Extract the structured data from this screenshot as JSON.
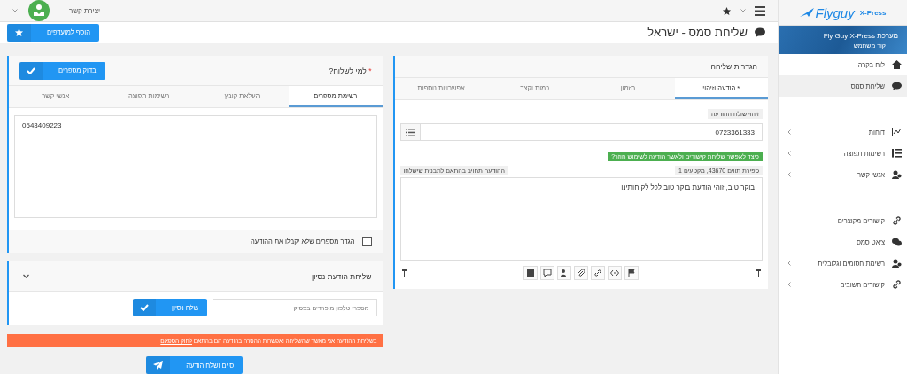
{
  "topbar": {
    "user_label": "יצירת קשר",
    "logo": {
      "word": "Flyguy",
      "suffix": "X-Press"
    }
  },
  "sidebar": {
    "header": {
      "title": "מערכת Fly Guy X-Press",
      "subtitle": "קוד משתמש"
    },
    "groups": [
      [
        {
          "label": "לוח בקרה",
          "selected": false,
          "expandable": false
        },
        {
          "label": "שליחת סמס",
          "selected": true,
          "expandable": false
        }
      ],
      [
        {
          "label": "דוחות",
          "selected": false,
          "expandable": true
        },
        {
          "label": "רשימות תפוצה",
          "selected": false,
          "expandable": true
        },
        {
          "label": "אנשי קשר",
          "selected": false,
          "expandable": true
        }
      ],
      [
        {
          "label": "קישורים מקוצרים",
          "selected": false,
          "expandable": false
        },
        {
          "label": "צ'אט סמס",
          "selected": false,
          "expandable": false
        },
        {
          "label": "רשימת חסומים וגלובלית",
          "selected": false,
          "expandable": true
        },
        {
          "label": "קישורים חשובים",
          "selected": false,
          "expandable": true
        }
      ]
    ]
  },
  "page": {
    "title": "שליחת סמס - ישראל",
    "favorite_button": "הוסף למועדפים"
  },
  "settings": {
    "title": "הגדרות שליחה",
    "tabs": [
      {
        "label": "* הודעה וזיהוי",
        "selected": true
      },
      {
        "label": "תזמון",
        "selected": false
      },
      {
        "label": "כמות וקצב",
        "selected": false
      },
      {
        "label": "אפשרויות נוספות",
        "selected": false
      }
    ],
    "sender_label": "זיהוי שולח ההודעה",
    "sender_value": "0723361333",
    "help_badge": "כיצד לאפשר שליחת קישורים ולאשר הודעה לשימוש חוזר?",
    "counter": "ספירת תווים 43670, מקטעים 1",
    "billing_note": "ההודעה תחויב בהתאם לתבנית שישלחו",
    "message": "בוקר טוב, זוהי הודעת בוקר טוב לכל לקוחותינו"
  },
  "recipients": {
    "title": "למי לשלוח?",
    "required_mark": "*",
    "check_button": "בדוק מספרים",
    "tabs": [
      {
        "label": "רשימת מספרים",
        "selected": true
      },
      {
        "label": "העלאת קובץ",
        "selected": false
      },
      {
        "label": "רשימות תפוצה",
        "selected": false
      },
      {
        "label": "אנשי קשר",
        "selected": false
      }
    ],
    "numbers": "0543409223",
    "exclude": {
      "label": "הגדר מספרים שלא יקבלו את ההודעה",
      "checked": false
    }
  },
  "test": {
    "title": "שליחת הודעת נסיון",
    "expanded": true,
    "placeholder": "מספרי טלפון מופרדים בפסיק",
    "button": "שלח נסיון"
  },
  "notice": {
    "text": "בשליחת ההודעה אני מאשר שהשליחה ואפשרות ההסרה בהודעה הם בהתאם",
    "link": "לחוק הספאם"
  },
  "send_button": "סיים ושלח הודעה"
}
